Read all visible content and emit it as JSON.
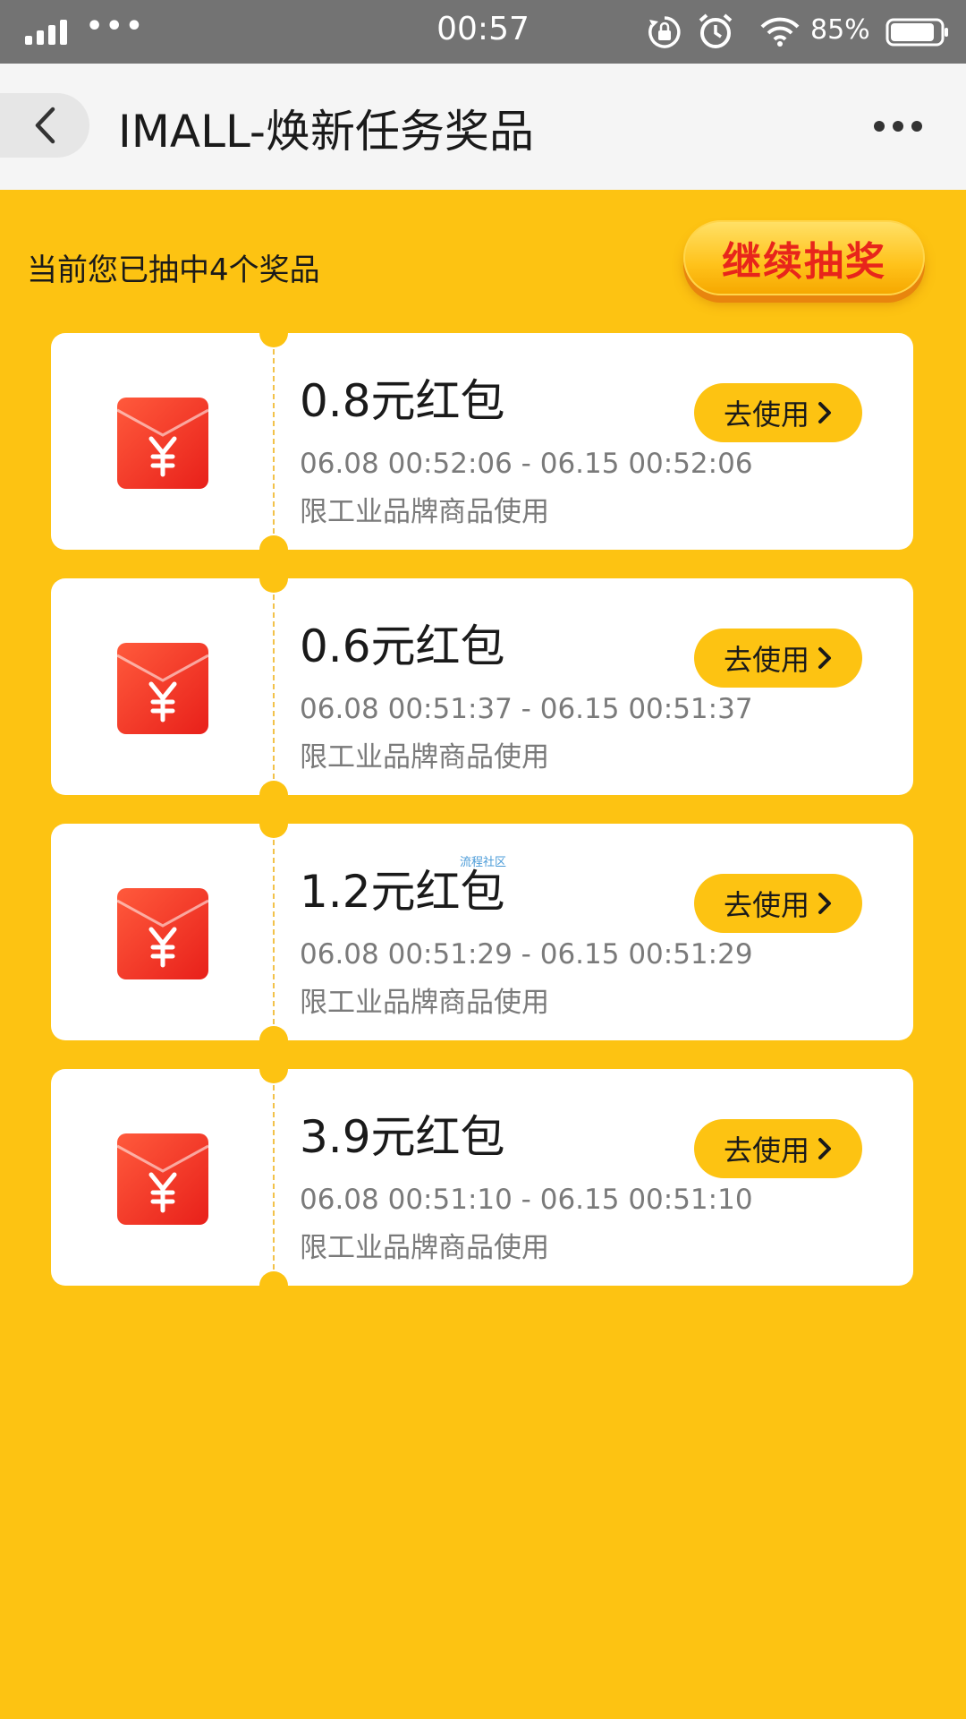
{
  "status_bar": {
    "dots": "•••",
    "time": "00:57",
    "battery_pct": "85%"
  },
  "nav": {
    "title": "IMALL-焕新任务奖品"
  },
  "header": {
    "summary": "当前您已抽中4个奖品",
    "continue_label": "继续抽奖"
  },
  "prizes": [
    {
      "name": "0.8元红包",
      "validity": "06.08 00:52:06 - 06.15 00:52:06",
      "restriction": "限工业品牌商品使用",
      "button_label": "去使用"
    },
    {
      "name": "0.6元红包",
      "validity": "06.08 00:51:37 - 06.15 00:51:37",
      "restriction": "限工业品牌商品使用",
      "button_label": "去使用"
    },
    {
      "name": "1.2元红包",
      "validity": "06.08 00:51:29 - 06.15 00:51:29",
      "restriction": "限工业品牌商品使用",
      "button_label": "去使用"
    },
    {
      "name": "3.9元红包",
      "validity": "06.08 00:51:10 - 06.15 00:51:10",
      "restriction": "限工业品牌商品使用",
      "button_label": "去使用"
    }
  ],
  "watermark": "流程社区",
  "colors": {
    "page_background": "#FDC312",
    "status_bar": "#737373",
    "nav_bar": "#F5F5F5",
    "envelope_red": "#F23A24",
    "continue_text": "#E8251B"
  }
}
